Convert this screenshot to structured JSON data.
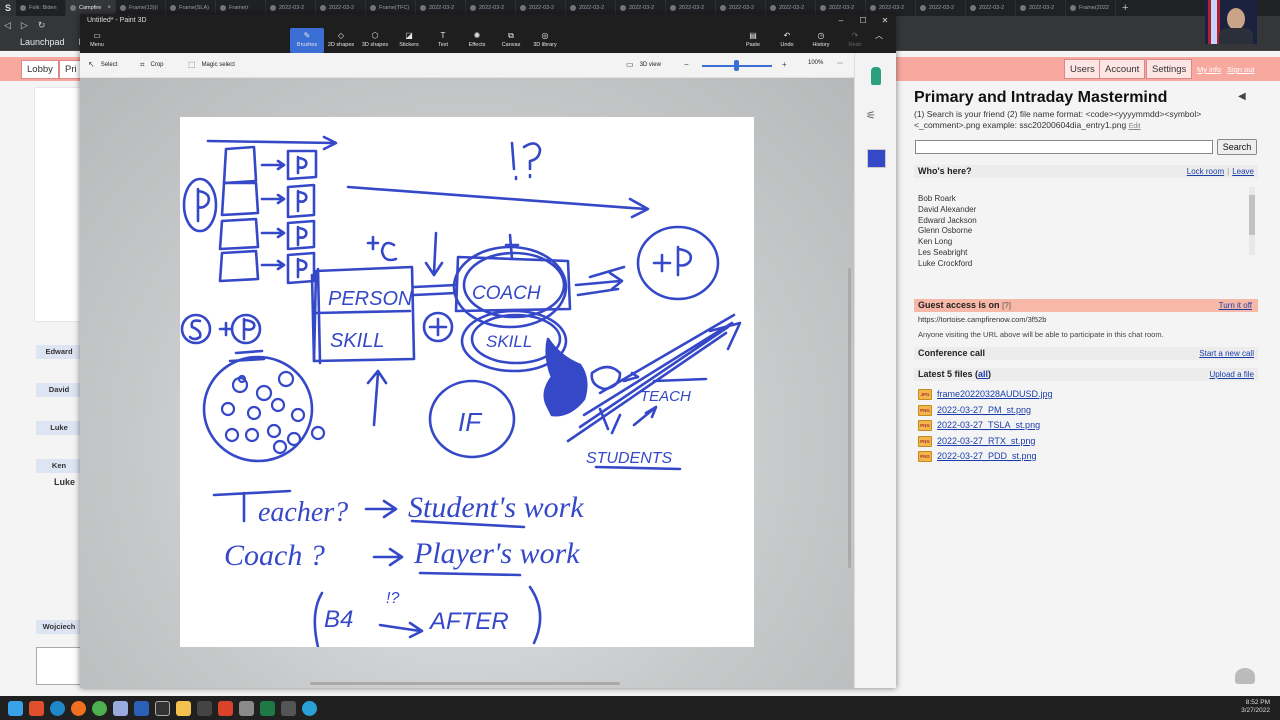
{
  "browser": {
    "tabs": [
      {
        "label": "Folk: Biden"
      },
      {
        "label": "Campfire",
        "active": true
      },
      {
        "label": "Frame(13)(i"
      },
      {
        "label": "Frame(SLA)"
      },
      {
        "label": "Frame(r"
      },
      {
        "label": "2022-03-2"
      },
      {
        "label": "2022-03-2"
      },
      {
        "label": "Frame(TFC)"
      },
      {
        "label": "2022-03-2"
      },
      {
        "label": "2022-03-2"
      },
      {
        "label": "2022-03-2"
      },
      {
        "label": "2022-03-2"
      },
      {
        "label": "2022-03-2"
      },
      {
        "label": "2022-03-2"
      },
      {
        "label": "2022-03-2"
      },
      {
        "label": "2022-03-2"
      },
      {
        "label": "2022-03-2"
      },
      {
        "label": "2022-03-2"
      },
      {
        "label": "2022-03-2"
      },
      {
        "label": "2022-03-2"
      },
      {
        "label": "2022-03-2"
      },
      {
        "label": "Frame(2022"
      }
    ],
    "bookmarks": [
      "Launchpad",
      "Ba"
    ]
  },
  "campfire": {
    "nav_tabs": [
      "Lobby",
      "Pri"
    ],
    "right_nav": [
      "Users",
      "Account",
      "Settings"
    ],
    "header_links": [
      "My info",
      "Sign out"
    ],
    "message_names": [
      "Edward",
      "David",
      "Luke",
      "Ken",
      "Luke",
      "Wojciech"
    ],
    "room": {
      "title": "Primary and Intraday Mastermind",
      "description": "(1) Search is your friend (2) file name format: <code><yyyymmdd><symbol><_comment>.png example: ssc20200604dia_entry1.png",
      "edit_label": "Edit",
      "search_button": "Search",
      "whos_here_label": "Who's here?",
      "lock_room": "Lock room",
      "leave": "Leave",
      "people": [
        "Bob Roark",
        "David Alexander",
        "Edward Jackson",
        "Glenn Osborne",
        "Ken Long",
        "Les Seabright",
        "Luke Crockford"
      ],
      "guest_label": "Guest access is on",
      "guest_help": "?",
      "turn_off": "Turn it off",
      "guest_url": "https://tortoise.campfirenow.com/3f52b",
      "guest_note": "Anyone visiting the URL above will be able to participate in this chat room.",
      "conference_label": "Conference call",
      "start_call": "Start a new call",
      "files_label": "Latest 5 files",
      "files_all": "all",
      "upload": "Upload a file",
      "files": [
        {
          "name": "frame20220328AUDUSD.jpg",
          "type": "JPG"
        },
        {
          "name": "2022-03-27_PM_st.png",
          "type": "PNG"
        },
        {
          "name": "2022-03-27_TSLA_st.png",
          "type": "PNG"
        },
        {
          "name": "2022-03-27_RTX_st.png",
          "type": "PNG"
        },
        {
          "name": "2022-03-27_PDD_st.png",
          "type": "PNG"
        }
      ]
    }
  },
  "paint3d": {
    "title": "Untitled* - Paint 3D",
    "ribbon": {
      "menu": "Menu",
      "tools": [
        "Brushes",
        "2D shapes",
        "3D shapes",
        "Stickers",
        "Text",
        "Effects",
        "Canvas",
        "3D library"
      ],
      "actions": [
        "Paste",
        "Undo",
        "History",
        "Redo"
      ]
    },
    "cmdbar": {
      "select": "Select",
      "crop": "Crop",
      "magic_select": "Magic select",
      "view3d": "3D view",
      "zoom": "100%",
      "zoom_fraction": 0.48
    },
    "brush_color": "#3548c8"
  },
  "taskbar": {
    "time": "8:52 PM",
    "date": "3/27/2022"
  }
}
